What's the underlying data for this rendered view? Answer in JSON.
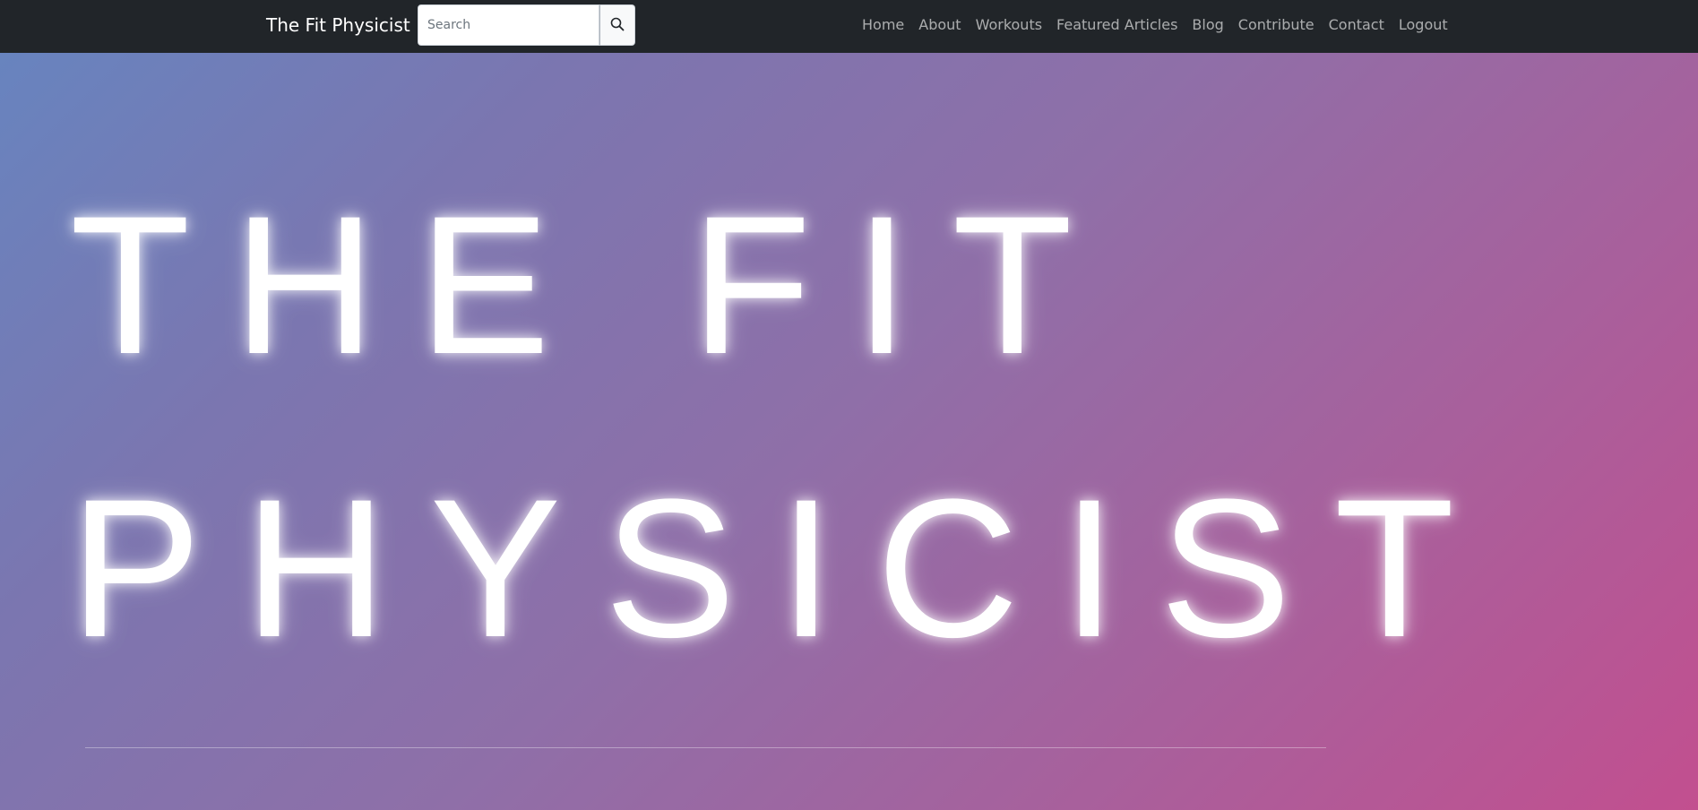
{
  "navbar": {
    "brand": "The Fit Physicist",
    "search": {
      "placeholder": "Search",
      "value": "",
      "button_icon": "search-icon"
    },
    "links": [
      {
        "label": "Home"
      },
      {
        "label": "About"
      },
      {
        "label": "Workouts"
      },
      {
        "label": "Featured Articles"
      },
      {
        "label": "Blog"
      },
      {
        "label": "Contribute"
      },
      {
        "label": "Contact"
      },
      {
        "label": "Logout"
      }
    ],
    "colors": {
      "background": "#212529",
      "brand_text": "#ffffff",
      "link_text": "#b4b5b7"
    }
  },
  "hero": {
    "line1": "THE FIT",
    "line2": "PHYSICIST",
    "colors": {
      "gradient_start": "#6685c0",
      "gradient_end": "#c24f8f",
      "text": "#ffffff"
    }
  }
}
